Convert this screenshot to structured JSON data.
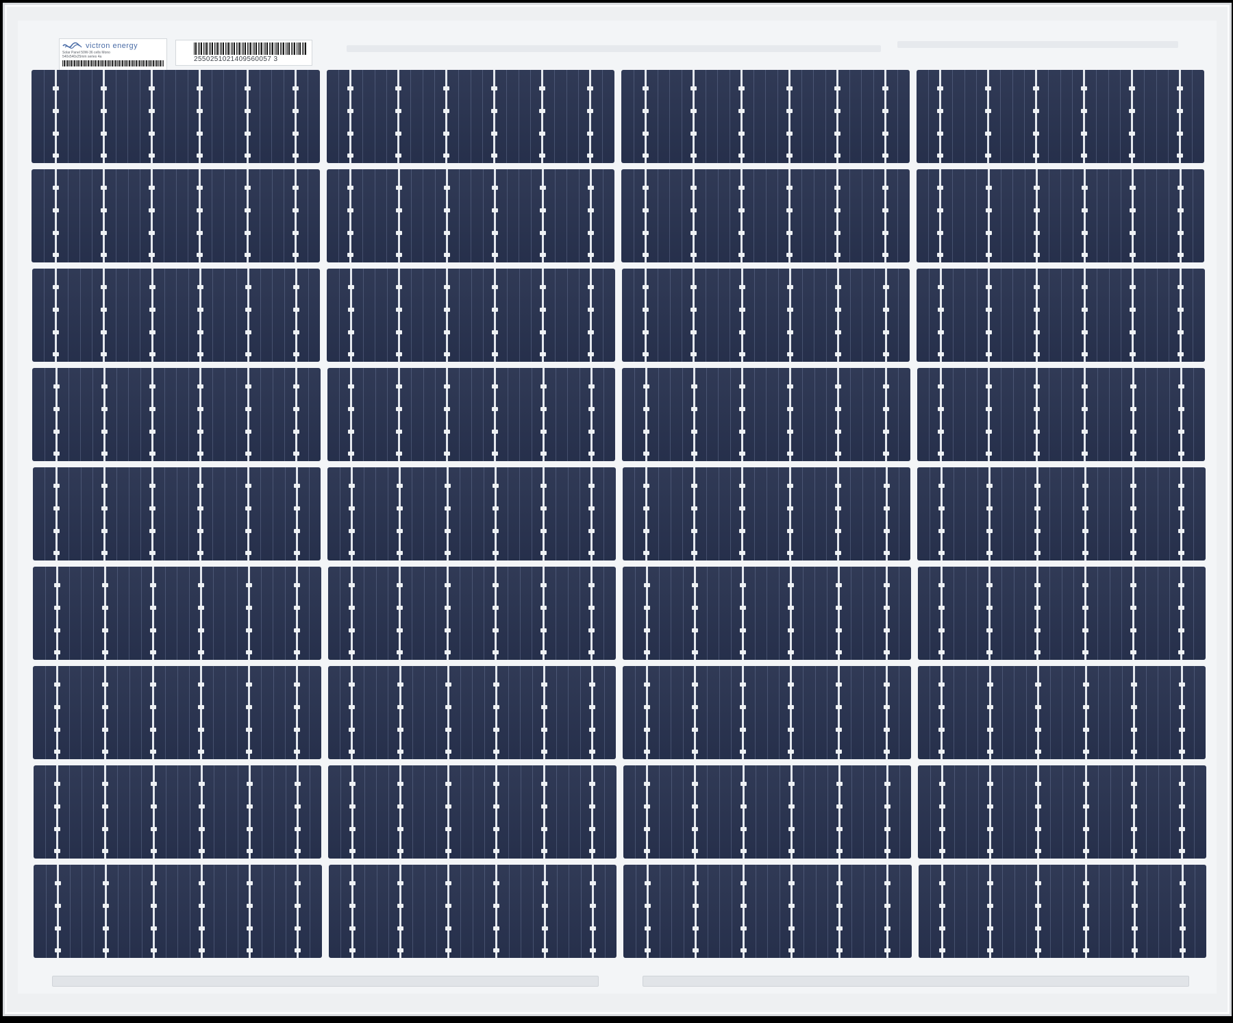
{
  "scene": {
    "subject": "solar-panel",
    "colors": {
      "background": "#000000",
      "frame": "#eef0f2",
      "cell": "#28324f",
      "busbar": "#e4e8ee"
    },
    "cells": {
      "rows": 9,
      "column_groups": 4,
      "busbars_per_cell": 6
    }
  },
  "labels": {
    "brand": "victron energy",
    "spec": "Solar Panel 50W-36 cells Mono",
    "spec2": "540x540x25mm series 4a",
    "serial": "2550251021409560057 3",
    "logo_icon": "victron-logo-icon"
  }
}
